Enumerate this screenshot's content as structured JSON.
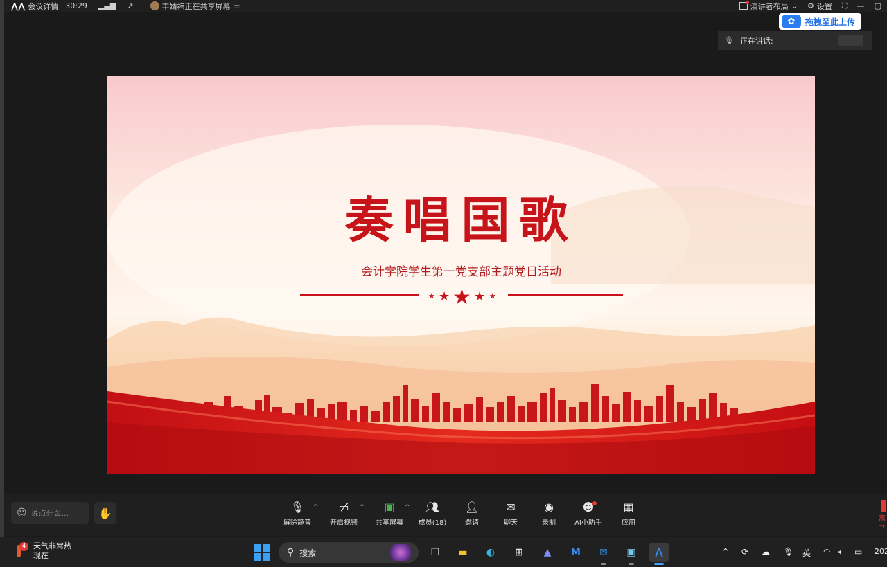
{
  "topbar": {
    "meeting_details": "会议详情",
    "elapsed": "30:29",
    "sharing_status": "丰婧祎正在共享屏幕",
    "layout_label": "演讲者布局",
    "settings_label": "设置"
  },
  "upload_badge": {
    "label": "拖拽至此上传"
  },
  "speaking_panel": {
    "label": "正在讲话:"
  },
  "slide": {
    "title": "奏唱国歌",
    "subtitle": "会计学院学生第一党支部主题党日活动",
    "colors": {
      "accent": "#c7141b",
      "wave": "#d3161b"
    }
  },
  "toolbar": {
    "chat_placeholder": "说点什么...",
    "buttons": [
      {
        "id": "unmute",
        "label": "解除静音",
        "icon": "mic-off-icon"
      },
      {
        "id": "video",
        "label": "开启视频",
        "icon": "video-off-icon"
      },
      {
        "id": "share",
        "label": "共享屏幕",
        "icon": "share-screen-icon"
      },
      {
        "id": "members",
        "label": "成员(18)",
        "icon": "members-icon"
      },
      {
        "id": "invite",
        "label": "邀请",
        "icon": "invite-icon"
      },
      {
        "id": "chat",
        "label": "聊天",
        "icon": "chat-icon"
      },
      {
        "id": "record",
        "label": "录制",
        "icon": "record-icon"
      },
      {
        "id": "ai",
        "label": "AI小助手",
        "icon": "ai-assistant-icon"
      },
      {
        "id": "apps",
        "label": "应用",
        "icon": "apps-icon"
      }
    ],
    "leave_partial": "离开"
  },
  "taskbar": {
    "weather_badge": "4",
    "weather_title": "天气非常热",
    "weather_sub": "现在",
    "search_label": "搜索",
    "ime": "英",
    "clock_partial": "202"
  }
}
